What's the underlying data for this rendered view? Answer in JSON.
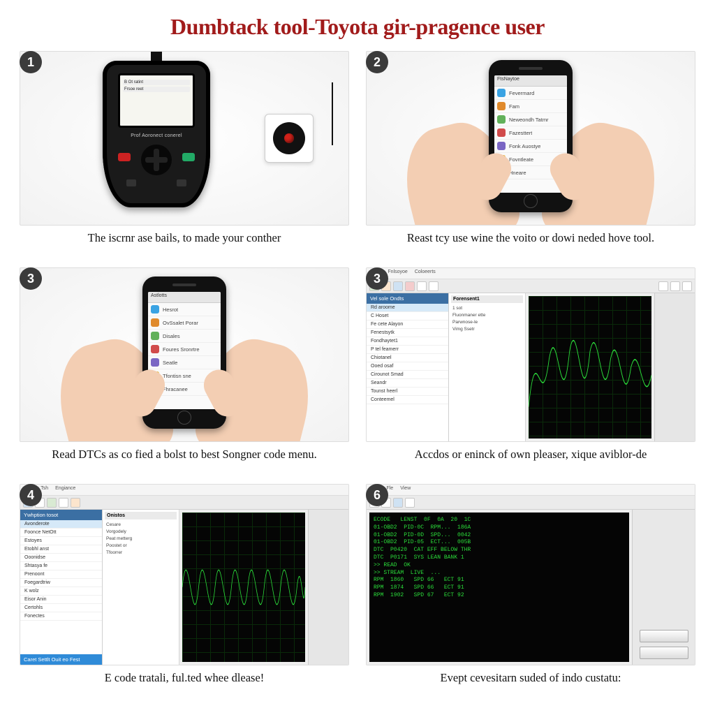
{
  "title": "Dumbtack tool-Toyota gir-pragence user",
  "icon_colors": [
    "#3aa3e3",
    "#e08a2c",
    "#62b15a",
    "#d14b4b",
    "#7a66c4",
    "#e3b22e",
    "#4cb2a5",
    "#c24e8a"
  ],
  "steps": [
    {
      "badge": "1",
      "caption": "The iscrnr ase bails, to made your conther",
      "scanner_brand": "Prof Aoronect conerel",
      "scanner_menu": [
        "B  Ot ratint",
        "Frsoe  reet"
      ]
    },
    {
      "badge": "2",
      "caption": "Reast tcy use wine the voito or dowi neded hove tool.",
      "phone_header": "FtsNaytoe",
      "phone_items": [
        "Fevermard",
        "Fam",
        "Neweondh Tatmr",
        "Fazesttert",
        "Fonk Auostye",
        "Fovntleate",
        "Hneare"
      ]
    },
    {
      "badge": "3",
      "caption": "Read DTCs as co fied a bolst to best Songner code menu.",
      "phone_header": "Astlotts",
      "phone_items": [
        "Hesrot",
        "OvSsalet Porar",
        "Disales",
        "Foures Sronrtre",
        "Seatle",
        "Tfontisn sne",
        "Fhracanee"
      ]
    },
    {
      "badge": "3",
      "caption": "Accdos or eninck of own pleaser, xique aviblor-de",
      "side_head": "Vel sole Ondts",
      "side_items": [
        "Rd aroome",
        "C Hoset",
        "Fe cete Alayon",
        "Fenestsytk",
        "Fondhaytet1",
        "P tel feamerr",
        "Chiotanel",
        "Ooed osaf",
        "Cirounot Smad",
        "Seandr",
        "Tounst heerl",
        "Conteemel"
      ],
      "side2_head": "Forensent1",
      "side2_items": [
        "1 sot",
        "Fluonmaner ette",
        "Parwnose-le",
        "Vimg Ssetr"
      ]
    },
    {
      "badge": "4",
      "caption": "E code tratali, ful.ted whee dlease!",
      "side_head": "Ywhption tosot",
      "side_items": [
        "Avonderote",
        "Foonce NetOtt",
        "Estoyes",
        "Etobhl anst",
        "Ooonidse",
        "Shtasya fe",
        "Prenoont",
        "Foegardtriw",
        "K wolz",
        "Eisor Anin",
        "Certohls",
        "Fonectes"
      ],
      "side_foot": "Caret Settlt  Ouit  eo Fest",
      "side2_head": "Onistos",
      "side2_items": [
        "Cesare",
        "Vorgodely",
        "Peat metterg",
        "Poostet or",
        "Tfoorrer"
      ]
    },
    {
      "badge": "6",
      "caption": "Evept cevesitarn suded of indo custatu:",
      "term_lines": [
        "ECODE   LENST  0F  0A  20  1C",
        "01-OBD2  PID-0C  RPM...  186A",
        "01-OBD2  PID-0D  SPD...  0042",
        "01-OBD2  PID-05  ECT...  005B",
        "DTC  P0420  CAT EFF BELOW THR",
        "DTC  P0171  SYS LEAN BANK 1",
        ">> READ  OK",
        ">> STREAM  LIVE  ...",
        "RPM  1860   SPD 66   ECT 91",
        "RPM  1874   SPD 66   ECT 91",
        "RPM  1902   SPD 67   ECT 92"
      ]
    }
  ]
}
